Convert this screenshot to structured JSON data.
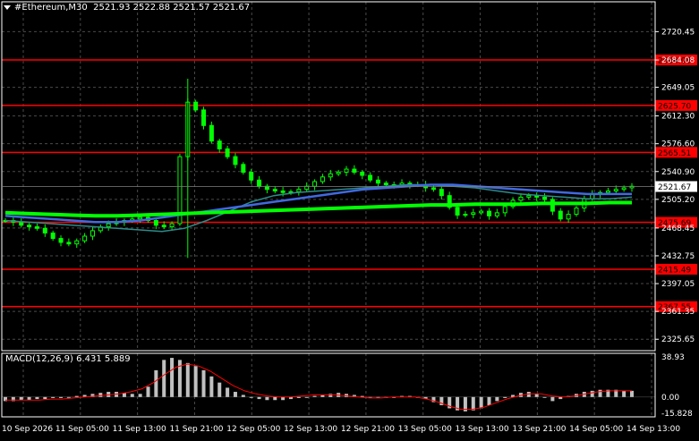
{
  "header": {
    "symbol": "#Ethereum,M30",
    "ohlc": "2521.93 2522.88 2521.57 2521.67"
  },
  "macd": {
    "label": "MACD(12,26,9) 6.431 5.889",
    "scale_labels": [
      "38.93",
      "0.00",
      "-15.828"
    ]
  },
  "colors": {
    "background": "#000000",
    "grid": "#4a4a4a",
    "axis": "#ffffff",
    "candle": "#00ff00",
    "ma_fast": "#2e8b8b",
    "ma_mid": "#4169e1",
    "ma_slow": "#00ff00",
    "level_line": "#ff0000",
    "level_tag": "#ff0000",
    "price_tag": "#000000",
    "macd_hist": "#c0c0c0",
    "macd_signal": "#ff0000"
  },
  "chart_data": [
    {
      "type": "candlestick",
      "title": "#Ethereum,M30",
      "ylim": [
        2311,
        2745
      ],
      "y_ticks": [
        "2720.45",
        "2684.08",
        "2649.05",
        "2612.30",
        "2576.60",
        "2540.90",
        "2505.20",
        "2468.45",
        "2432.75",
        "2397.05",
        "2361.35",
        "2325.65"
      ],
      "x_ticks": [
        "10 Sep 2026",
        "11 Sep 05:00",
        "11 Sep 13:00",
        "11 Sep 21:00",
        "12 Sep 05:00",
        "12 Sep 13:00",
        "12 Sep 21:00",
        "13 Sep 05:00",
        "13 Sep 13:00",
        "13 Sep 21:00",
        "14 Sep 05:00",
        "14 Sep 13:00"
      ],
      "current_price": "2521.67",
      "levels": [
        {
          "value": 2684.08,
          "label": "2684.08"
        },
        {
          "value": 2625.7,
          "label": "2625.70"
        },
        {
          "value": 2565.51,
          "label": "2565.51"
        },
        {
          "value": 2475.69,
          "label": "2475.69"
        },
        {
          "value": 2415.49,
          "label": "2415.49"
        },
        {
          "value": 2367.55,
          "label": "2367.55"
        }
      ],
      "price_path": [
        2478,
        2476,
        2472,
        2470,
        2468,
        2462,
        2455,
        2450,
        2448,
        2452,
        2458,
        2465,
        2470,
        2474,
        2476,
        2478,
        2480,
        2482,
        2478,
        2472,
        2470,
        2474,
        2560,
        2630,
        2620,
        2600,
        2580,
        2570,
        2560,
        2550,
        2540,
        2530,
        2522,
        2518,
        2516,
        2514,
        2515,
        2518,
        2522,
        2528,
        2534,
        2538,
        2540,
        2544,
        2540,
        2536,
        2530,
        2526,
        2524,
        2524,
        2526,
        2524,
        2524,
        2520,
        2518,
        2510,
        2495,
        2485,
        2486,
        2488,
        2490,
        2484,
        2488,
        2496,
        2504,
        2508,
        2510,
        2508,
        2505,
        2490,
        2480,
        2486,
        2494,
        2506,
        2512,
        2514,
        2516,
        2518,
        2520,
        2522
      ],
      "ma_fast": [
        2478,
        2476,
        2474,
        2472,
        2470,
        2468,
        2466,
        2464,
        2468,
        2478,
        2490,
        2502,
        2510,
        2514,
        2516,
        2518,
        2520,
        2522,
        2524,
        2524,
        2522,
        2520,
        2516,
        2512,
        2510,
        2508,
        2506,
        2506,
        2508
      ],
      "ma_mid": [
        2484,
        2482,
        2480,
        2478,
        2476,
        2476,
        2478,
        2482,
        2486,
        2490,
        2494,
        2498,
        2502,
        2506,
        2510,
        2514,
        2518,
        2520,
        2522,
        2524,
        2524,
        2522,
        2520,
        2518,
        2516,
        2514,
        2512,
        2512,
        2512
      ],
      "ma_slow": [
        2488,
        2487,
        2486,
        2485,
        2484,
        2484,
        2485,
        2486,
        2487,
        2488,
        2489,
        2490,
        2491,
        2492,
        2493,
        2494,
        2495,
        2496,
        2497,
        2498,
        2498,
        2499,
        2499,
        2499,
        2500,
        2500,
        2500,
        2501,
        2501
      ]
    },
    {
      "type": "bar",
      "title": "MACD(12,26,9) 6.431 5.889",
      "ylim": [
        -15.828,
        38.93
      ],
      "histogram": [
        -4,
        -4,
        -3,
        -3,
        -2,
        -2,
        -1,
        -1,
        0,
        1,
        2,
        3,
        4,
        5,
        5,
        4,
        3,
        3,
        10,
        26,
        36,
        38,
        36,
        33,
        30,
        26,
        20,
        14,
        9,
        5,
        2,
        0,
        -2,
        -3,
        -3,
        -3,
        -2,
        -1,
        0,
        1,
        2,
        3,
        4,
        3,
        2,
        1,
        0,
        -1,
        -1,
        0,
        1,
        1,
        0,
        -2,
        -5,
        -8,
        -11,
        -13,
        -14,
        -13,
        -11,
        -8,
        -4,
        -1,
        2,
        4,
        5,
        3,
        0,
        -4,
        -2,
        1,
        3,
        5,
        6,
        7,
        7,
        7,
        6,
        6
      ],
      "signal": [
        -3,
        -3,
        -3,
        -3,
        -2,
        -2,
        -1,
        0,
        1,
        2,
        3,
        5,
        8,
        14,
        22,
        29,
        32,
        30,
        25,
        18,
        11,
        6,
        3,
        1,
        0,
        0,
        1,
        2,
        2,
        2,
        1,
        0,
        -1,
        -1,
        0,
        0,
        0,
        -2,
        -5,
        -9,
        -12,
        -12,
        -10,
        -6,
        -2,
        1,
        3,
        3,
        1,
        0,
        1,
        3,
        5,
        6,
        6,
        6
      ]
    }
  ]
}
